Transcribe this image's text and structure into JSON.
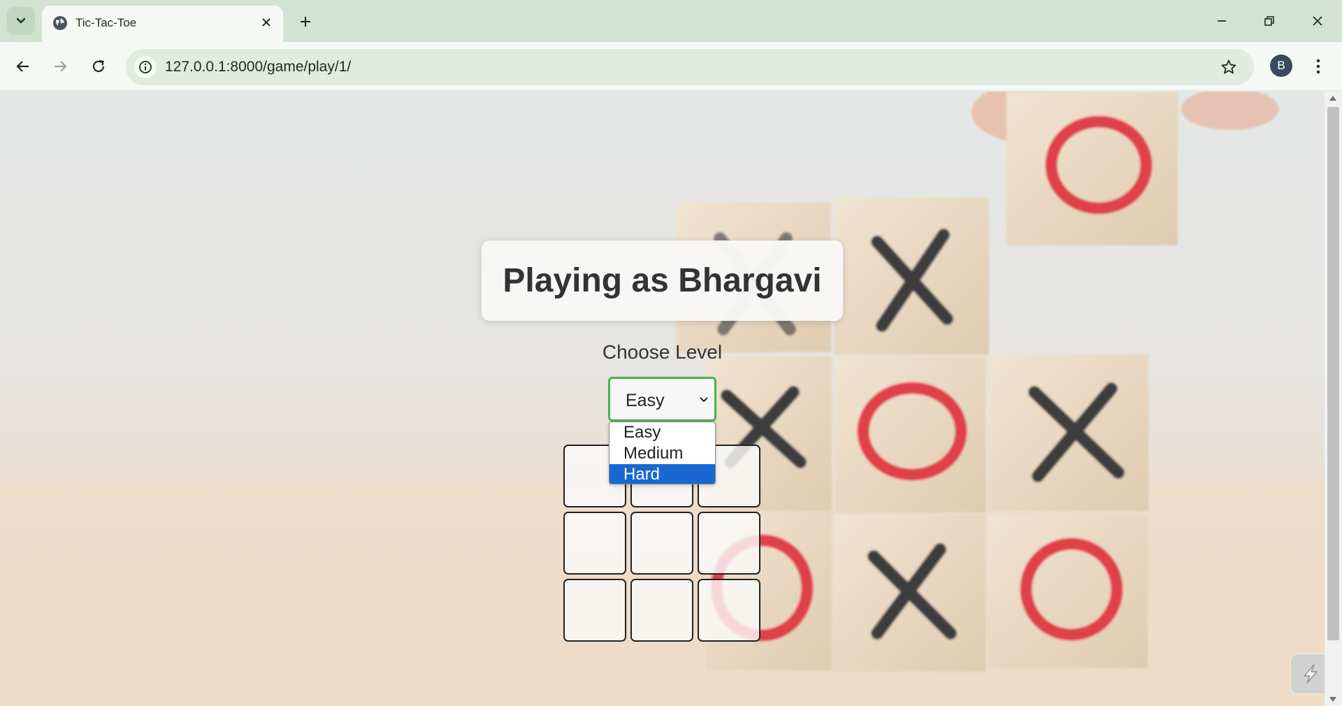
{
  "browser": {
    "tab_title": "Tic-Tac-Toe",
    "url": "127.0.0.1:8000/game/play/1/",
    "profile_initial": "B",
    "icons": {
      "tab_search": "chevron-down-icon",
      "favicon": "globe-icon",
      "tab_close": "close-icon",
      "new_tab": "plus-icon",
      "minimize": "minimize-icon",
      "restore": "restore-icon",
      "close_window": "close-icon",
      "back": "back-arrow-icon",
      "forward": "forward-arrow-icon",
      "reload": "reload-icon",
      "site_info": "info-icon",
      "bookmark": "star-icon",
      "menu": "kebab-menu-icon"
    },
    "colors": {
      "tabstrip": "#d3e3d1",
      "toolbar": "#f5f9f3",
      "omnibox": "#e2ebe0"
    }
  },
  "page": {
    "title": "Playing as Bhargavi",
    "level_label": "Choose Level",
    "level_select": {
      "value": "Easy",
      "options": [
        "Easy",
        "Medium",
        "Hard"
      ],
      "highlighted": "Hard",
      "open": true
    },
    "board": {
      "cells": [
        "",
        "",
        "",
        "",
        "",
        "",
        "",
        "",
        ""
      ]
    },
    "colors": {
      "select_border": "#4caf50",
      "option_highlight": "#1967d2",
      "o_mark": "#e04048",
      "x_mark": "#3c3c3c"
    }
  }
}
